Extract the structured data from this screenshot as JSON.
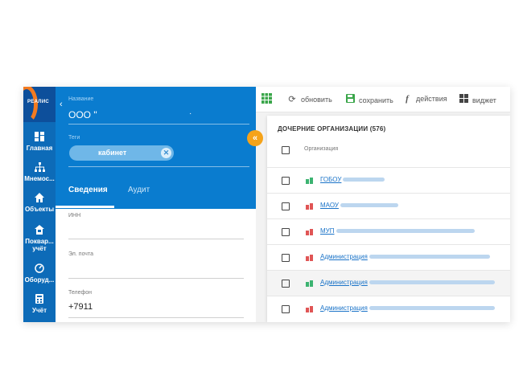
{
  "nav": {
    "logo_text": "РЕАЛИС",
    "items": [
      {
        "label": "Главная",
        "icon": "dashboard-icon"
      },
      {
        "label": "Мнемос...",
        "icon": "sitemap-icon"
      },
      {
        "label": "Объекты",
        "icon": "home-icon"
      },
      {
        "label": "Поквар... учёт",
        "icon": "building-icon"
      },
      {
        "label": "Оборуд...",
        "icon": "gauge-icon"
      },
      {
        "label": "Учёт",
        "icon": "calculator-icon"
      }
    ]
  },
  "header": {
    "name_label": "Название",
    "name_value": "ООО \"",
    "tags_label": "Теги",
    "tag": "кабинет",
    "tabs": [
      "Сведения",
      "Аудит"
    ]
  },
  "fields": [
    {
      "label": "ИНН",
      "value": ""
    },
    {
      "label": "Эл. почта",
      "value": ""
    },
    {
      "label": "Телефон",
      "value": "+7911"
    }
  ],
  "toolbar": {
    "refresh": "обновить",
    "save": "сохранить",
    "actions": "действия",
    "widgets": "виджет"
  },
  "card": {
    "title": "ДОЧЕРНИЕ ОРГАНИЗАЦИИ (576)",
    "column": "Организация",
    "rows": [
      {
        "name": "ГОБОУ",
        "color": "#3cb371"
      },
      {
        "name": "МАОУ",
        "color": "#e05555"
      },
      {
        "name": "МУП",
        "color": "#e05555"
      },
      {
        "name": "Администрация",
        "color": "#e05555"
      },
      {
        "name": "Администрация",
        "color": "#3cb371"
      },
      {
        "name": "Администрация",
        "color": "#e05555"
      }
    ]
  },
  "colors": {
    "primary": "#0a7ccf",
    "accent": "#f5a31a",
    "link": "#1a73c8"
  }
}
